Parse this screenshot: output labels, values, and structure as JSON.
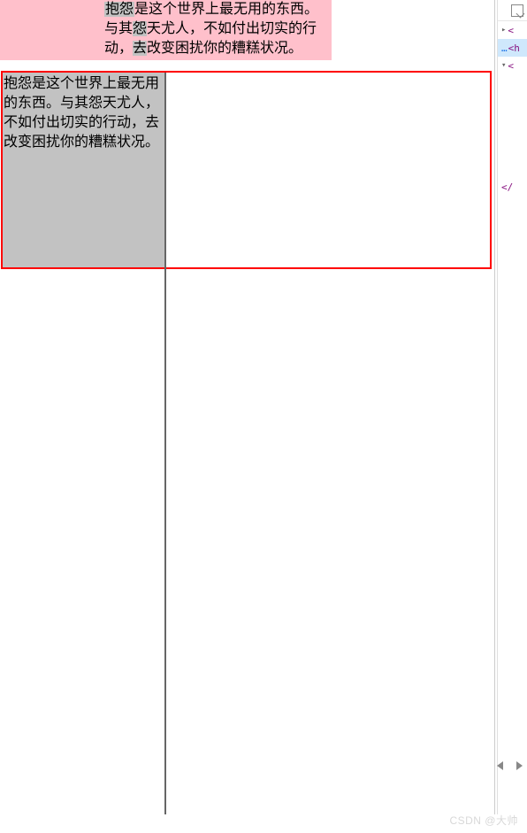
{
  "content": {
    "paragraph_line1": "抱怨是这个世界上最无用的东西。",
    "paragraph_line2a": "与其怨天尤人，不如付出切实的行",
    "paragraph_line2b": "动，去改变困扰你的糟糕状况。",
    "gray_box_text": "抱怨是这个世界上最无用的东西。与其怨天尤人，不如付出切实的行动，去改变困扰你的糟糕状况。"
  },
  "devtools": {
    "row1_prefix": "<",
    "row2_dots": "…",
    "row2_prefix": "<h",
    "row3_prefix": "<",
    "closing": "</"
  },
  "watermark": "CSDN @大帅"
}
